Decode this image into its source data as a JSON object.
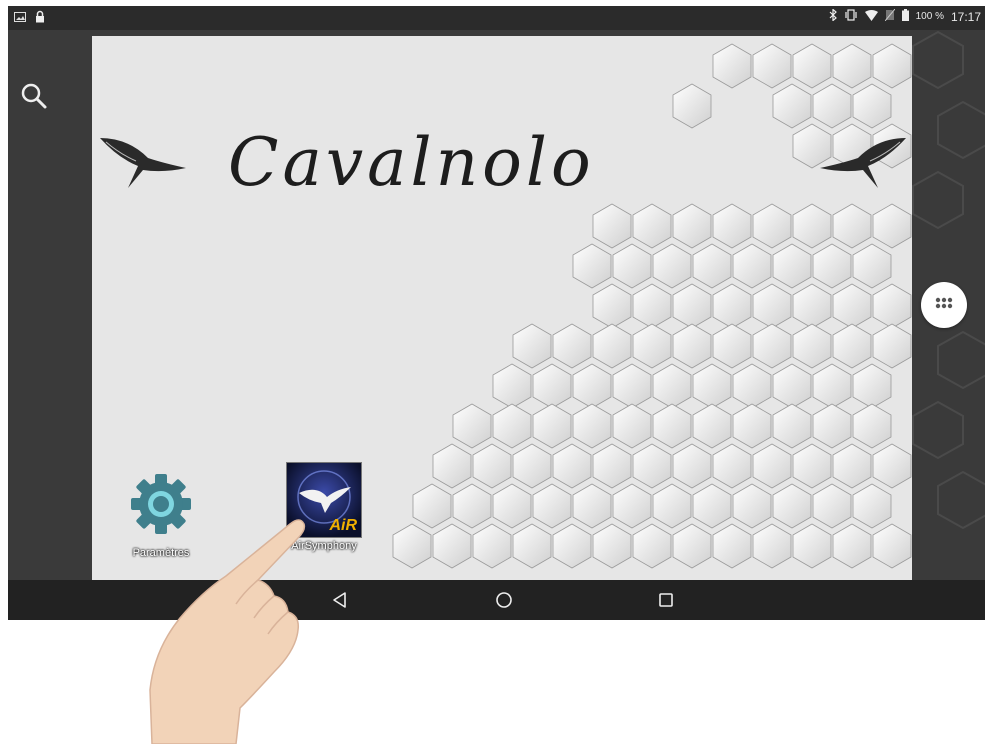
{
  "statusbar": {
    "time": "17:17",
    "battery_percent": "100 %",
    "left_icons": [
      "image-icon",
      "lock-icon"
    ],
    "right_icons": [
      "bluetooth-icon",
      "vibrate-icon",
      "wifi-icon",
      "no-sim-icon",
      "battery-icon"
    ]
  },
  "wallpaper": {
    "brand_text": "Cavalnolo"
  },
  "apps": [
    {
      "label": "Paramètres",
      "icon": "settings-gear-icon"
    },
    {
      "label": "AirSymphony",
      "icon": "airsymphony-app-icon",
      "badge": "AiR"
    }
  ],
  "navbar": {
    "buttons": [
      "back-icon",
      "home-icon",
      "recents-icon"
    ]
  },
  "colors": {
    "status_bar": "#2b2b2b",
    "nav_bar": "#222222",
    "wallpaper": "#e6e6e6",
    "settings_teal": "#3f7f8c"
  }
}
